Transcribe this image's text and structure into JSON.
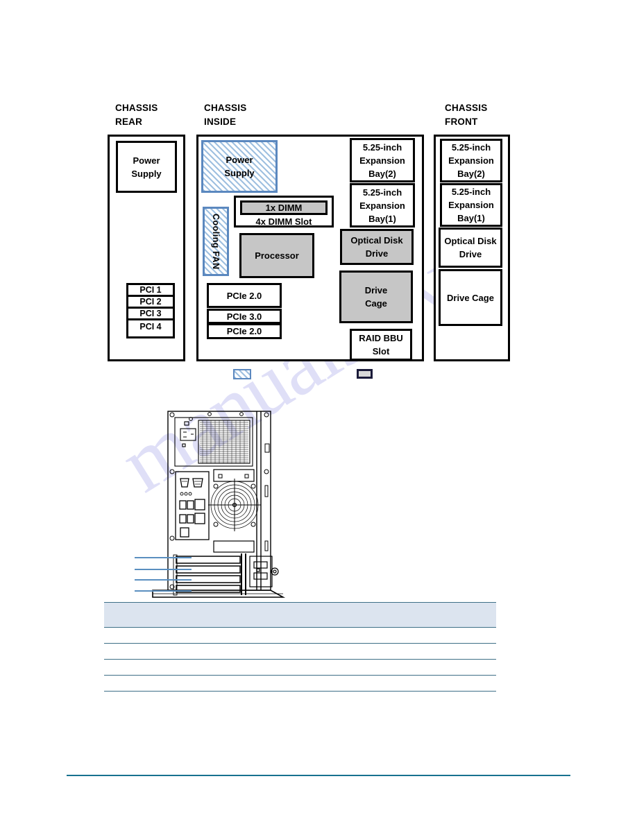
{
  "page": {
    "watermark_text": "manualshive.com"
  },
  "diagram": {
    "columns": [
      {
        "id": "rear",
        "title": "CHASSIS\nREAR"
      },
      {
        "id": "inside",
        "title": "CHASSIS\nINSIDE"
      },
      {
        "id": "front",
        "title": "CHASSIS\nFRONT"
      }
    ],
    "rear": {
      "power_supply": "Power\nSupply",
      "pci_slots": [
        "PCI 1",
        "PCI 2",
        "PCI 3",
        "PCI 4"
      ]
    },
    "inside": {
      "power_supply": "Power\nSupply",
      "cooling_fan": "Cooling FAN",
      "dimm_installed": "1x DIMM",
      "dimm_slots": "4x DIMM Slot",
      "processor": "Processor",
      "pcie_slots": [
        "PCIe 2.0",
        "PCIe 3.0",
        "PCIe 2.0"
      ],
      "bay2": "5.25-inch\nExpansion\nBay(2)",
      "bay1": "5.25-inch\nExpansion\nBay(1)",
      "optical_disk_drive": "Optical Disk\nDrive",
      "drive_cage": "Drive\nCage",
      "raid_bbu": "RAID BBU\nSlot"
    },
    "front": {
      "bay2": "5.25-inch\nExpansion\nBay(2)",
      "bay1": "5.25-inch\nExpansion\nBay(1)",
      "optical_disk_drive": "Optical Disk\nDrive",
      "drive_cage": "Drive Cage"
    },
    "legend": {
      "hatched_swatch": "",
      "solid_swatch": ""
    },
    "colors": {
      "hatch_border": "#5b88bf",
      "hatch_fill": "#9fc0e0",
      "gray_fill": "#c6c6c6",
      "outline": "#000000",
      "callout_line": "#5a8fc0",
      "table_rule": "#3d6e86",
      "table_header_fill": "#dce4ef",
      "footer_rule": "#17718f"
    }
  },
  "tower": {
    "callouts": [
      "",
      "",
      "",
      ""
    ]
  },
  "table": {
    "header_cells": [
      "",
      "",
      ""
    ],
    "rows": [
      [
        "",
        "",
        ""
      ],
      [
        "",
        "",
        ""
      ],
      [
        "",
        "",
        ""
      ],
      [
        "",
        "",
        ""
      ]
    ]
  }
}
